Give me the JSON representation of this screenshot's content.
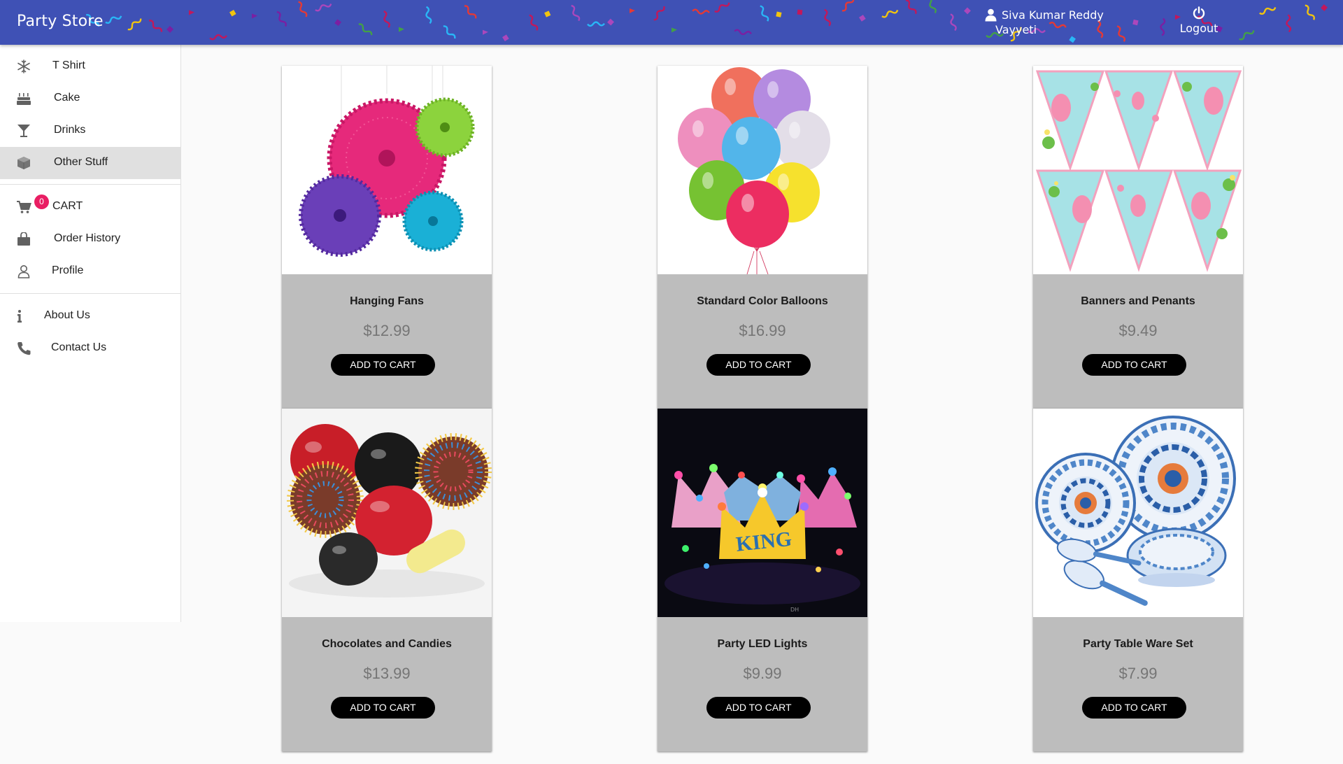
{
  "app": {
    "title": "Party Store",
    "user_first_line": "Siva Kumar Reddy",
    "user_second_line": "Vayyeti",
    "logout_label": "Logout",
    "colors": {
      "appbar": "#3f51b5",
      "badge": "#e91e63",
      "selected": "#e0e0e0",
      "card_content": "#bdbdbd"
    }
  },
  "sidebar": {
    "categories": [
      {
        "label": "T Shirt",
        "icon": "snowflake-icon"
      },
      {
        "label": "Cake",
        "icon": "cake-icon"
      },
      {
        "label": "Drinks",
        "icon": "cocktail-glass-icon"
      },
      {
        "label": "Other Stuff",
        "icon": "cube-icon",
        "selected": true
      }
    ],
    "account": [
      {
        "label": "CART",
        "icon": "shopping-cart-icon",
        "badge": "0"
      },
      {
        "label": "Order History",
        "icon": "shopping-bag-icon"
      },
      {
        "label": "Profile",
        "icon": "user-outline-icon"
      }
    ],
    "info": [
      {
        "label": "About Us",
        "icon": "info-icon"
      },
      {
        "label": "Contact Us",
        "icon": "phone-icon"
      }
    ]
  },
  "products": [
    {
      "name": "Hanging Fans",
      "price": "$12.99",
      "button": "ADD TO CART",
      "image": "paper-fans-image"
    },
    {
      "name": "Standard Color Balloons",
      "price": "$16.99",
      "button": "ADD TO CART",
      "image": "balloons-image"
    },
    {
      "name": "Banners and Penants",
      "price": "$9.49",
      "button": "ADD TO CART",
      "image": "flamingo-pennants-image"
    },
    {
      "name": "Chocolates and Candies",
      "price": "$13.99",
      "button": "ADD TO CART",
      "image": "candies-image"
    },
    {
      "name": "Party LED Lights",
      "price": "$9.99",
      "button": "ADD TO CART",
      "image": "led-crowns-image"
    },
    {
      "name": "Party Table Ware Set",
      "price": "$7.99",
      "button": "ADD TO CART",
      "image": "tableware-image"
    }
  ]
}
